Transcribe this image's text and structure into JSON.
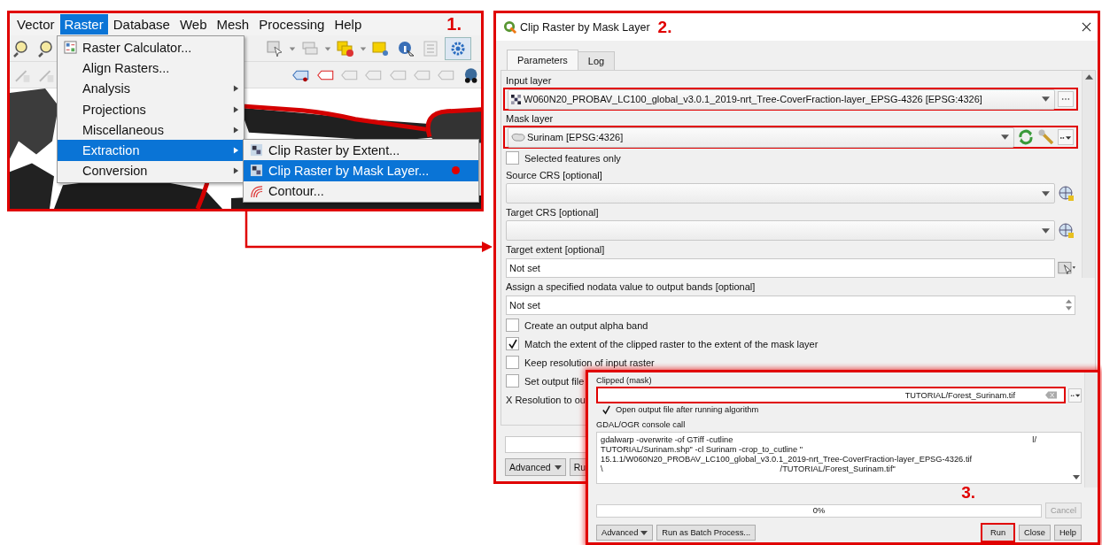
{
  "step1": {
    "label": "1.",
    "menubar": [
      {
        "label": "Vector",
        "selected": false
      },
      {
        "label": "Raster",
        "selected": true
      },
      {
        "label": "Database",
        "selected": false
      },
      {
        "label": "Web",
        "selected": false
      },
      {
        "label": "Mesh",
        "selected": false
      },
      {
        "label": "Processing",
        "selected": false
      },
      {
        "label": "Help",
        "selected": false
      }
    ],
    "raster_menu": [
      {
        "label": "Raster Calculator...",
        "kind": "calculator",
        "submenu": false,
        "selected": false
      },
      {
        "label": "Align Rasters...",
        "submenu": false,
        "selected": false
      },
      {
        "label": "Analysis",
        "submenu": true,
        "selected": false
      },
      {
        "label": "Projections",
        "submenu": true,
        "selected": false
      },
      {
        "label": "Miscellaneous",
        "submenu": true,
        "selected": false
      },
      {
        "label": "Extraction",
        "submenu": true,
        "selected": true
      },
      {
        "label": "Conversion",
        "submenu": true,
        "selected": false
      }
    ],
    "extraction_submenu": [
      {
        "label": "Clip Raster by Extent...",
        "kind": "raster",
        "selected": false,
        "click_mark": false
      },
      {
        "label": "Clip Raster by Mask Layer...",
        "kind": "raster",
        "selected": true,
        "click_mark": true
      },
      {
        "label": "Contour...",
        "kind": "contour",
        "selected": false,
        "click_mark": false
      }
    ]
  },
  "dialog": {
    "title": "Clip Raster by Mask Layer",
    "label": "2.",
    "tabs": [
      {
        "label": "Parameters",
        "selected": true
      },
      {
        "label": "Log",
        "selected": false
      }
    ],
    "params": [
      {
        "kind": "layer",
        "label": "Input layer",
        "value": "W060N20_PROBAV_LC100_global_v3.0.1_2019-nrt_Tree-CoverFraction-layer_EPSG-4326 [EPSG:4326]",
        "highlighted": true
      },
      {
        "kind": "vector",
        "label": "Mask layer",
        "value": "Surinam [EPSG:4326]",
        "highlighted": true
      },
      {
        "kind": "checkbox",
        "label": "Selected features only",
        "checked": false
      },
      {
        "kind": "crs",
        "label": "Source CRS [optional]"
      },
      {
        "kind": "crs",
        "label": "Target CRS [optional]"
      },
      {
        "kind": "extent",
        "label": "Target extent [optional]",
        "value": "Not set"
      },
      {
        "kind": "spin",
        "label": "Assign a specified nodata value to output bands [optional]",
        "value": "Not set"
      },
      {
        "kind": "checkbox",
        "label": "Create an output alpha band",
        "checked": false
      },
      {
        "kind": "checkbox",
        "label": "Match the extent of the clipped raster to the extent of the mask layer",
        "checked": true
      },
      {
        "kind": "checkbox",
        "label": "Keep resolution of input raster",
        "checked": false
      },
      {
        "kind": "checkbox",
        "label": "Set output file",
        "checked": false
      },
      {
        "kind": "text",
        "label": "X Resolution to ou"
      }
    ],
    "progress": {
      "level": 0
    },
    "buttons": [
      {
        "label": "Advanced",
        "kind": "menu"
      },
      {
        "label": "Ru",
        "kind": "plain"
      }
    ]
  },
  "step3": {
    "label": "3.",
    "output_label": "Clipped (mask)",
    "output_value": "TUTORIAL/Forest_Surinam.tif",
    "output_highlighted": true,
    "open_after": {
      "label": "Open output file after running algorithm",
      "checked": true
    },
    "console_label": "GDAL/OGR console call",
    "console_lines": [
      {
        "kind": "spread",
        "segments": [
          "gdalwarp -overwrite -of GTiff -cutline",
          "l/"
        ]
      },
      {
        "kind": "plain",
        "segments": [
          "TUTORIAL/Surinam.shp\" -cl Surinam -crop_to_cutline \""
        ]
      },
      {
        "kind": "plain",
        "segments": [
          "15.1.1/W060N20_PROBAV_LC100_global_v3.0.1_2019-nrt_Tree-CoverFraction-layer_EPSG-4326.tif"
        ]
      },
      {
        "kind": "gap",
        "segments": [
          "\\",
          "/TUTORIAL/Forest_Surinam.tif\""
        ]
      }
    ],
    "progress": {
      "level": 0,
      "reading": "0%"
    },
    "cancel": {
      "label": "Cancel",
      "disabled": true
    },
    "buttons": [
      {
        "label": "Advanced",
        "kind": "menu",
        "highlighted": false
      },
      {
        "label": "Run as Batch Process...",
        "kind": "plain",
        "highlighted": false
      },
      {
        "label": "Run",
        "kind": "plain",
        "highlighted": true
      },
      {
        "label": "Close",
        "kind": "plain",
        "highlighted": false
      },
      {
        "label": "Help",
        "kind": "plain",
        "highlighted": false
      }
    ]
  }
}
